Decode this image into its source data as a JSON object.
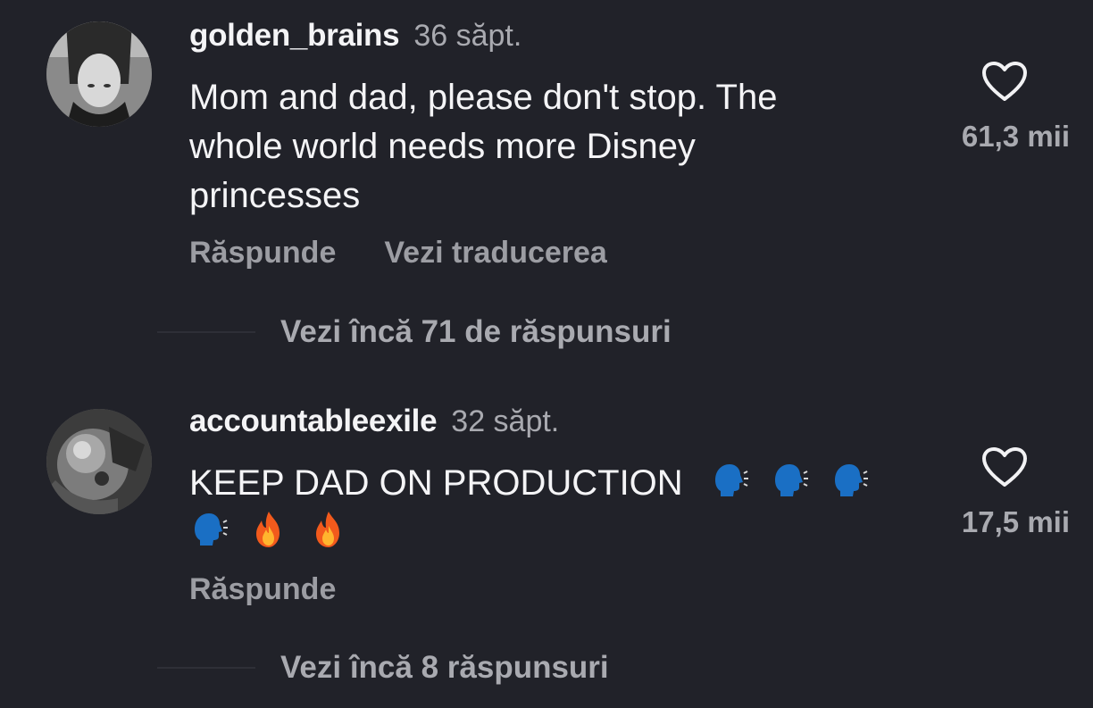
{
  "comments": [
    {
      "username": "golden_brains",
      "timestamp": "36 săpt.",
      "text_lines": [
        "Mom and dad, please don't stop. The",
        "whole world needs more Disney",
        "princesses"
      ],
      "like_count": "61,3 mii",
      "reply_label": "Răspunde",
      "translate_label": "Vezi traducerea",
      "more_replies": "Vezi încă 71 de răspunsuri"
    },
    {
      "username": "accountableexile",
      "timestamp": "32 săpt.",
      "text_line1": "KEEP DAD ON PRODUCTION",
      "emojis_line1": [
        "speaking-head",
        "speaking-head",
        "speaking-head"
      ],
      "emojis_line2": [
        "speaking-head",
        "fire",
        "fire"
      ],
      "like_count": "17,5 mii",
      "reply_label": "Răspunde",
      "more_replies": "Vezi încă 8 răspunsuri"
    }
  ],
  "colors": {
    "background": "#212229",
    "primary_text": "#f4f4f6",
    "secondary_text": "#a9aab0",
    "action_text": "#9c9da3"
  }
}
